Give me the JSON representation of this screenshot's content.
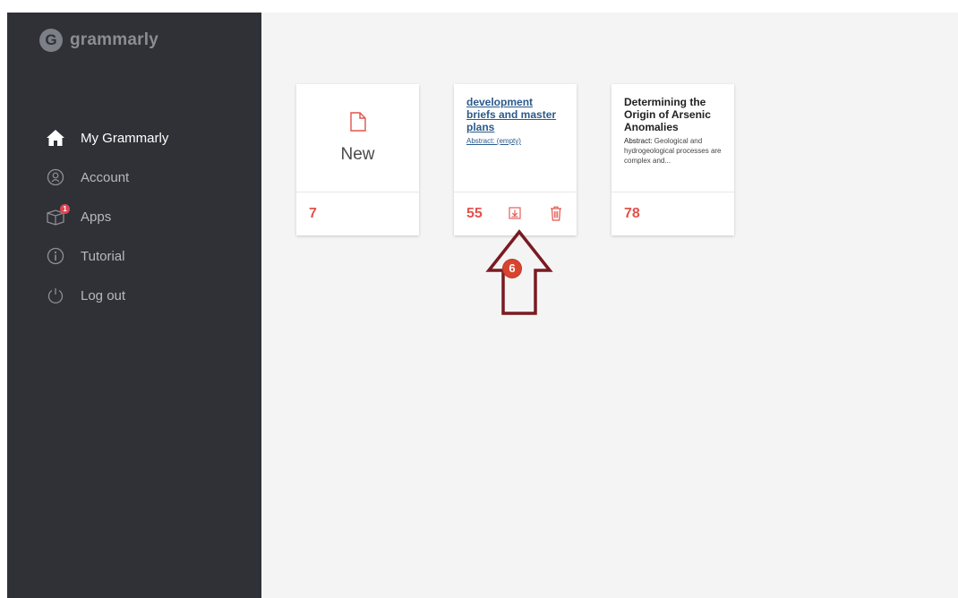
{
  "logo": {
    "badge": "G",
    "text": "grammarly"
  },
  "sidebar": {
    "items": [
      {
        "label": "My Grammarly",
        "icon": "home-icon",
        "active": true
      },
      {
        "label": "Account",
        "icon": "account-icon",
        "active": false
      },
      {
        "label": "Apps",
        "icon": "apps-box-icon",
        "active": false,
        "badge": "1"
      },
      {
        "label": "Tutorial",
        "icon": "info-icon",
        "active": false
      },
      {
        "label": "Log out",
        "icon": "power-icon",
        "active": false
      }
    ]
  },
  "cards": {
    "new_card": {
      "label": "New",
      "count": "7",
      "icon": "new-document-icon"
    },
    "doc1": {
      "title": "development briefs and master plans",
      "abstract": "Abstract: (empty)",
      "count": "55",
      "download_icon": "download-icon",
      "delete_icon": "trash-icon"
    },
    "doc2": {
      "title": "Determining the Origin of Arsenic Anomalies",
      "abstract_label": "Abstract:",
      "abstract_text": " Geological and hydrogeological processes are complex and...",
      "count": "78"
    }
  },
  "annotation": {
    "step_number": "6",
    "arrow_color": "#7a1a22",
    "badge_color": "#d9442f"
  },
  "colors": {
    "sidebar_bg": "#2f3137",
    "main_bg": "#f4f4f4",
    "accent_red": "#e2534b",
    "link_blue": "#2b5a8c"
  }
}
